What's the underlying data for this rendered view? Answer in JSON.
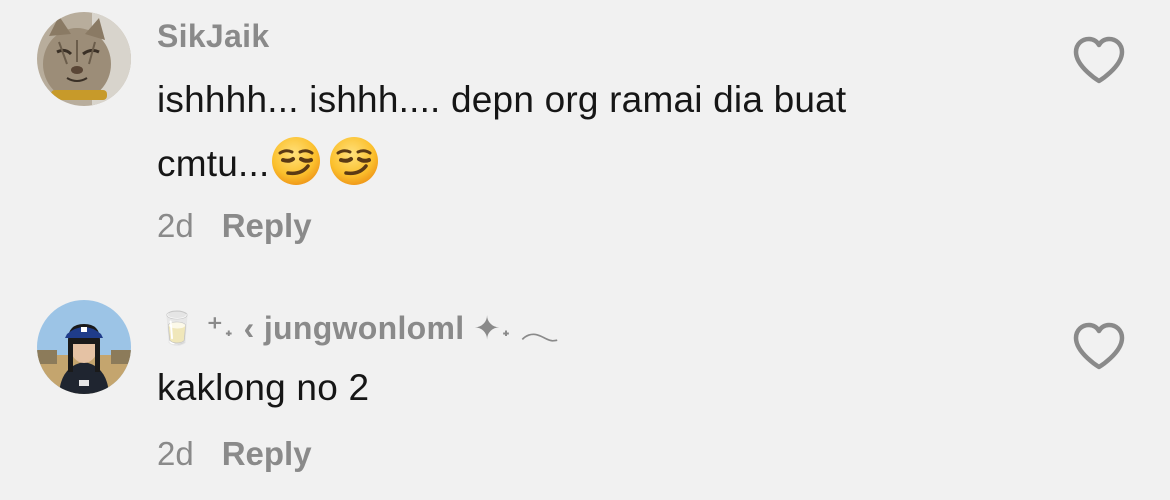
{
  "comments": [
    {
      "username": "SikJaik",
      "text_line1": "ishhhh... ishhh.... depn org ramai dia buat",
      "text_line2": "cmtu...",
      "emojis": [
        "smirk-emoji",
        "smirk-emoji"
      ],
      "age": "2d",
      "reply_label": "Reply",
      "avatar": "cat-avatar",
      "like_icon": "heart-outline-icon"
    },
    {
      "username_prefix": "🥛 ⁺˖ ‹ ",
      "username": "jungwonloml",
      "username_suffix": " ✦˖ 𓂃",
      "text_line1": "kaklong no 2",
      "age": "2d",
      "reply_label": "Reply",
      "avatar": "person-avatar",
      "like_icon": "heart-outline-icon"
    }
  ],
  "colors": {
    "background": "#f1f1f1",
    "username": "#8a8a8a",
    "text": "#161616",
    "meta": "#8a8a8a",
    "icon": "#8a8a8a"
  }
}
